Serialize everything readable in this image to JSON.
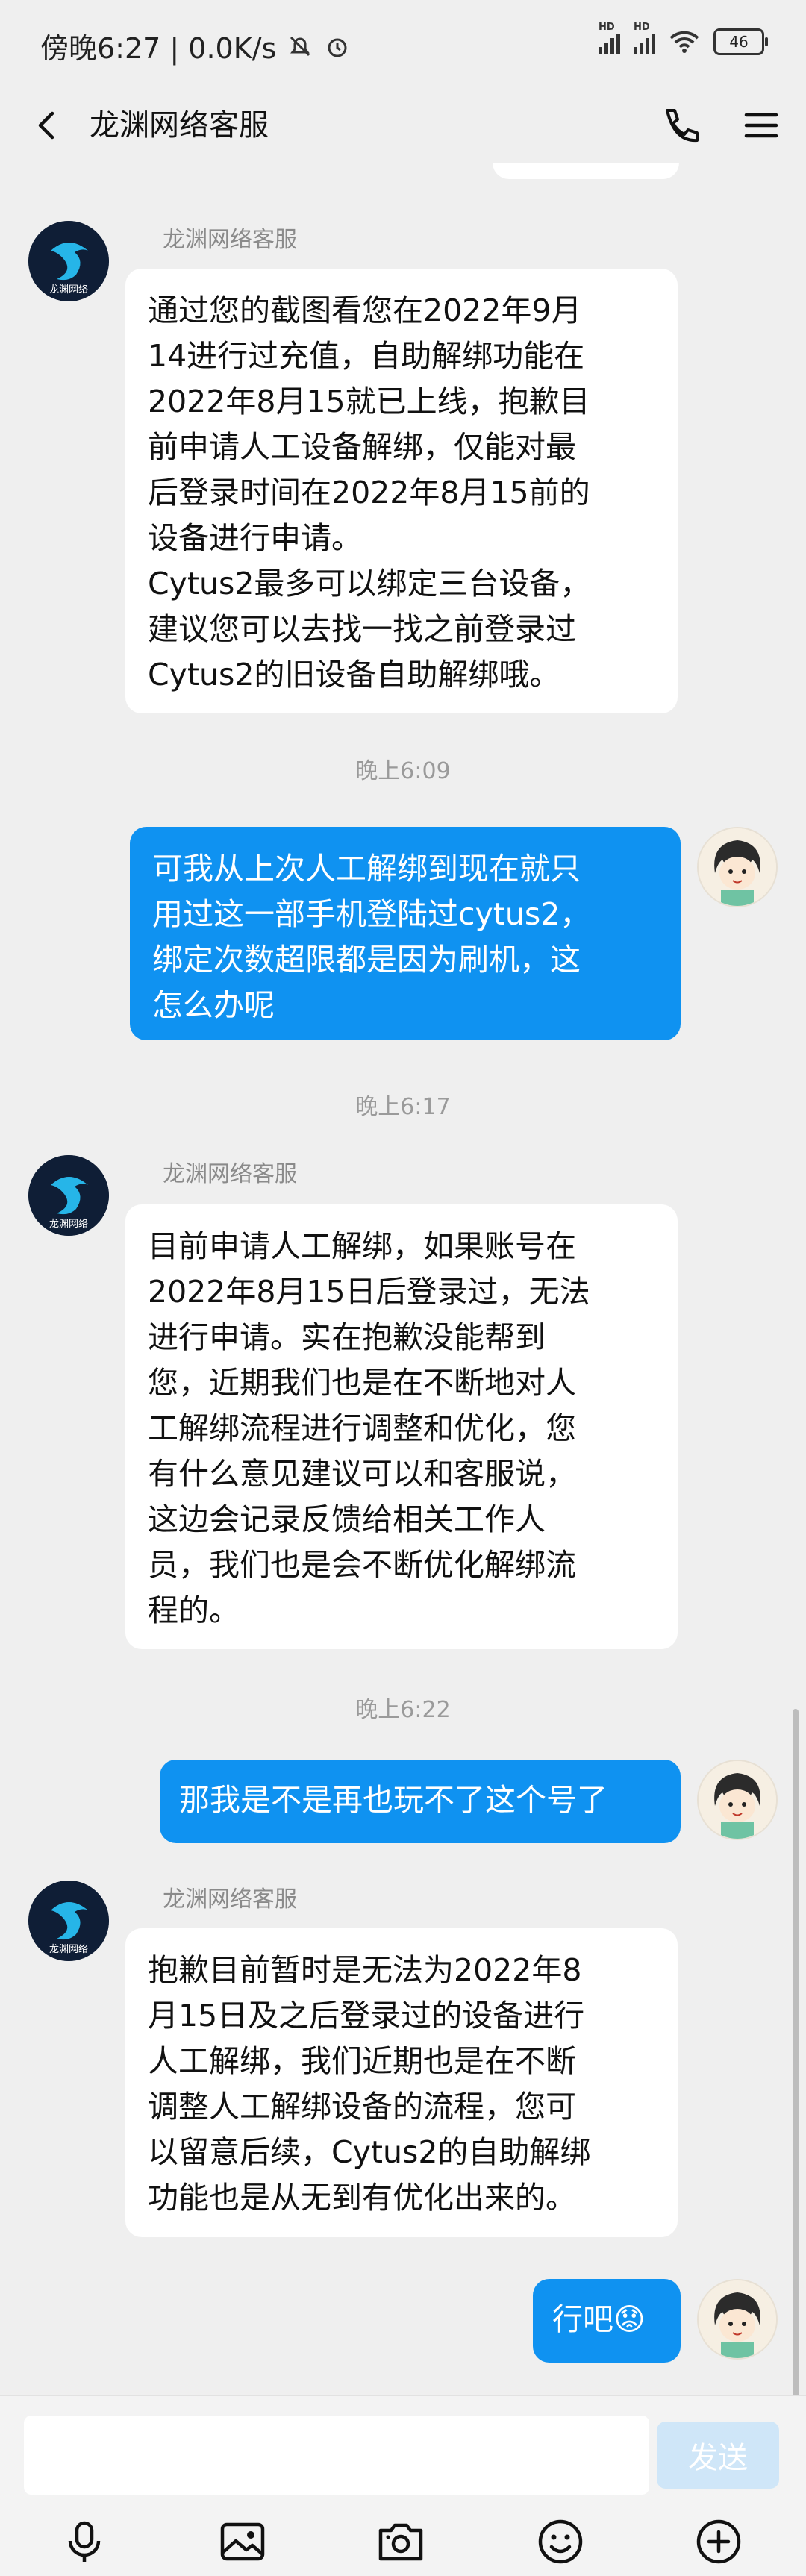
{
  "status_bar": {
    "time": "傍晚6:27 | 0.0K/s",
    "battery": "46",
    "sim_label": "HD"
  },
  "header": {
    "title": "龙渊网络客服"
  },
  "agent": {
    "name": "龙渊网络客服",
    "avatar_text": "龙渊网络"
  },
  "messages": [
    {
      "from": "agent",
      "sender": "龙渊网络客服",
      "text": "通过您的截图看您在2022年9月\n14进行过充值，自助解绑功能在\n2022年8月15就已上线，抱歉目\n前申请人工设备解绑，仅能对最\n后登录时间在2022年8月15前的\n设备进行申请。\nCytus2最多可以绑定三台设备，\n建议您可以去找一找之前登录过\nCytus2的旧设备自助解绑哦。"
    },
    {
      "timestamp": "晚上6:09"
    },
    {
      "from": "user",
      "text": "可我从上次人工解绑到现在就只\n用过这一部手机登陆过cytus2，\n绑定次数超限都是因为刷机，这\n怎么办呢"
    },
    {
      "timestamp": "晚上6:17"
    },
    {
      "from": "agent",
      "sender": "龙渊网络客服",
      "text": "目前申请人工解绑，如果账号在\n2022年8月15日后登录过，无法\n进行申请。实在抱歉没能帮到\n您，近期我们也是在不断地对人\n工解绑流程进行调整和优化，您\n有什么意见建议可以和客服说，\n这边会记录反馈给相关工作人\n员，我们也是会不断优化解绑流\n程的。"
    },
    {
      "timestamp": "晚上6:22"
    },
    {
      "from": "user",
      "text": "那我是不是再也玩不了这个号了"
    },
    {
      "from": "agent",
      "sender": "龙渊网络客服",
      "text": "抱歉目前暂时是无法为2022年8\n月15日及之后登录过的设备进行\n人工解绑，我们近期也是在不断\n调整人工解绑设备的流程，您可\n以留意后续，Cytus2的自助解绑\n功能也是从无到有优化出来的。"
    },
    {
      "from": "user",
      "text": "行吧😟"
    }
  ],
  "input": {
    "value": "",
    "send_label": "发送"
  },
  "toolbar": {
    "icons": [
      "microphone-icon",
      "image-icon",
      "camera-icon",
      "emoji-icon",
      "add-icon"
    ]
  },
  "colors": {
    "outgoing_bubble": "#0f92f1",
    "incoming_bubble": "#ffffff",
    "background": "#efefef",
    "send_button_disabled": "#cfe6f8"
  }
}
